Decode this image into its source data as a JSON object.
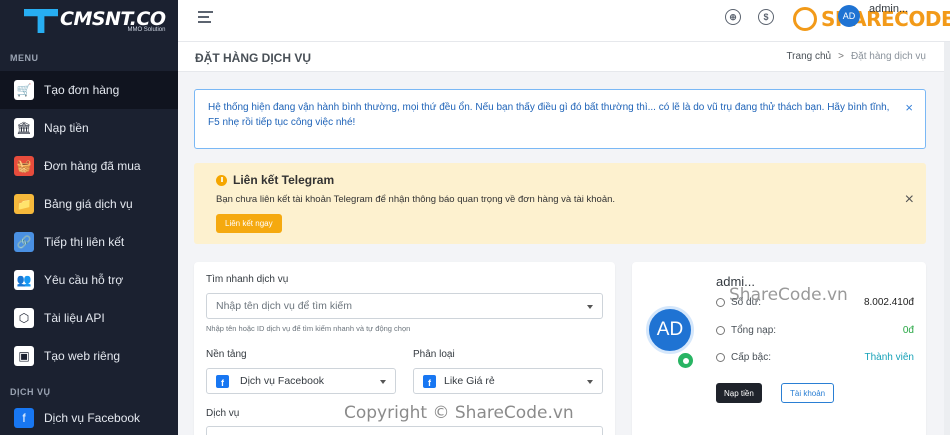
{
  "brand": {
    "name": "CMSNT.CO",
    "tagline": "MMO Solution"
  },
  "sidebar": {
    "section_menu": "MENU",
    "section_service": "DỊCH VỤ",
    "items": [
      {
        "label": "Tạo đơn hàng",
        "icon": "cart-icon",
        "color": "#ffffff",
        "active": true
      },
      {
        "label": "Nạp tiền",
        "icon": "bank-icon",
        "color": "#ffffff"
      },
      {
        "label": "Đơn hàng đã mua",
        "icon": "basket-icon",
        "color": "#e74c3c"
      },
      {
        "label": "Bảng giá dịch vụ",
        "icon": "folder-icon",
        "color": "#f6b93b"
      },
      {
        "label": "Tiếp thị liên kết",
        "icon": "link-icon",
        "color": "#4a90e2"
      },
      {
        "label": "Yêu cầu hỗ trợ",
        "icon": "support-icon",
        "color": "#ffffff"
      },
      {
        "label": "Tài liệu API",
        "icon": "api-icon",
        "color": "#ffffff"
      },
      {
        "label": "Tạo web riêng",
        "icon": "terminal-icon",
        "color": "#ffffff"
      }
    ],
    "cut_item": "Dịch vụ Facebook"
  },
  "topbar": {
    "user": "admin...",
    "avatar": "AD",
    "watermark_brand": "SHARECODE.vn"
  },
  "page": {
    "title": "ĐẶT HÀNG DỊCH VỤ",
    "breadcrumb_home": "Trang chủ",
    "breadcrumb_sep": ">",
    "breadcrumb_current": "Đặt hàng dịch vụ"
  },
  "notice": {
    "text": "Hệ thống hiện đang vận hành bình thường, mọi thứ đều ổn. Nếu bạn thấy điều gì đó bất thường thì... có lẽ là do vũ trụ đang thử thách bạn. Hãy bình tĩnh, F5 nhẹ rồi tiếp tục công việc nhé!",
    "close": "×"
  },
  "telegram": {
    "title": "Liên kết Telegram",
    "text": "Bạn chưa liên kết tài khoản Telegram để nhận thông báo quan trọng về đơn hàng và tài khoản.",
    "button": "Liên kết ngay",
    "close": "×"
  },
  "order_form": {
    "search_label": "Tìm nhanh dịch vụ",
    "search_placeholder": "Nhập tên dịch vụ để tìm kiếm",
    "search_help": "Nhập tên hoặc ID dịch vụ để tìm kiếm nhanh và tự động chọn",
    "platform_label": "Nền tảng",
    "platform_value": "Dịch vụ Facebook",
    "category_label": "Phân loại",
    "category_value": "Like Giá rẻ",
    "service_label": "Dịch vụ"
  },
  "profile": {
    "name": "admi...",
    "avatar": "AD",
    "balance_label": "Số dư:",
    "balance": "8.002.410đ",
    "total_label": "Tổng nạp:",
    "total": "0đ",
    "rank_label": "Cấp bậc:",
    "rank": "Thành viên",
    "deposit_button": "Nạp tiền",
    "account_button": "Tài khoản"
  },
  "watermarks": {
    "copyright": "Copyright © ShareCode.vn",
    "card": "ShareCode.vn"
  },
  "colors": {
    "sidebar": "#1b2130",
    "accent": "#1f73d3",
    "warning": "#f5a90f",
    "success": "#28b463"
  }
}
